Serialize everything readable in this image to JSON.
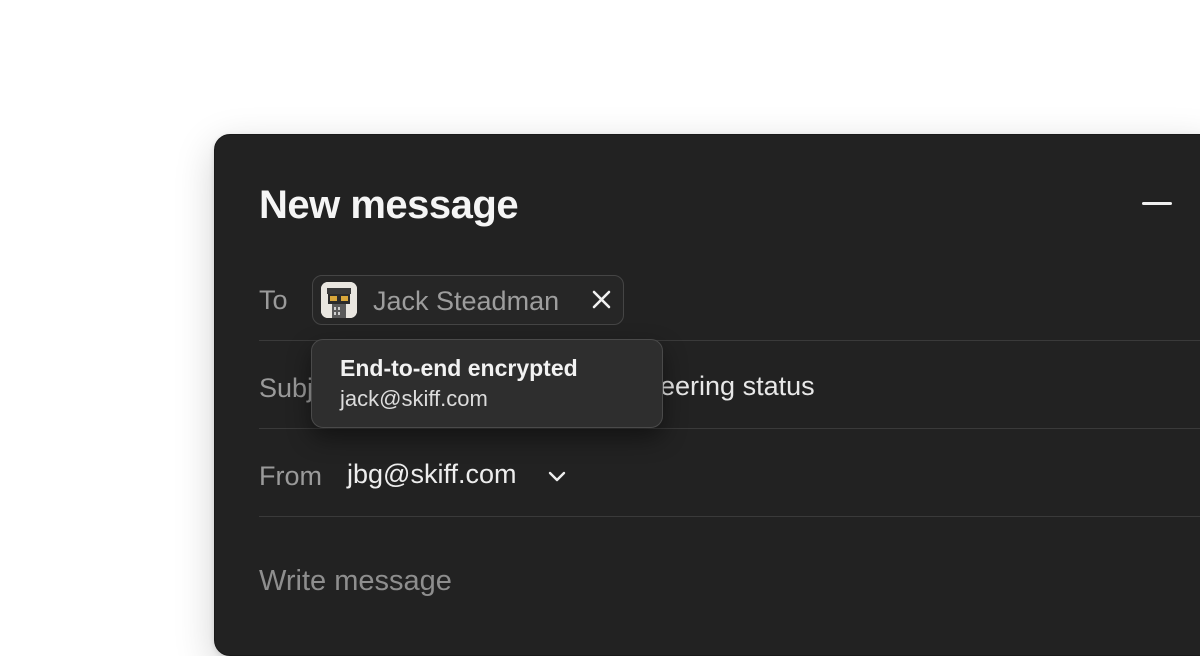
{
  "compose": {
    "title": "New message",
    "to_label": "To",
    "recipient": {
      "name": "Jack Steadman",
      "tooltip_title": "End-to-end encrypted",
      "tooltip_email": "jack@skiff.com"
    },
    "subject_label": "Subj",
    "subject_value_visible": "neering status",
    "from_label": "From",
    "from_value": "jbg@skiff.com",
    "body_placeholder": "Write message"
  },
  "icons": {
    "minimize": "minimize-icon",
    "remove_recipient": "close-icon",
    "from_dropdown": "chevron-down-icon",
    "avatar": "avatar"
  },
  "colors": {
    "window_bg": "#222222",
    "page_bg": "#ffffff",
    "tooltip_bg": "#2e2e2e",
    "divider": "#3a3a3a"
  }
}
